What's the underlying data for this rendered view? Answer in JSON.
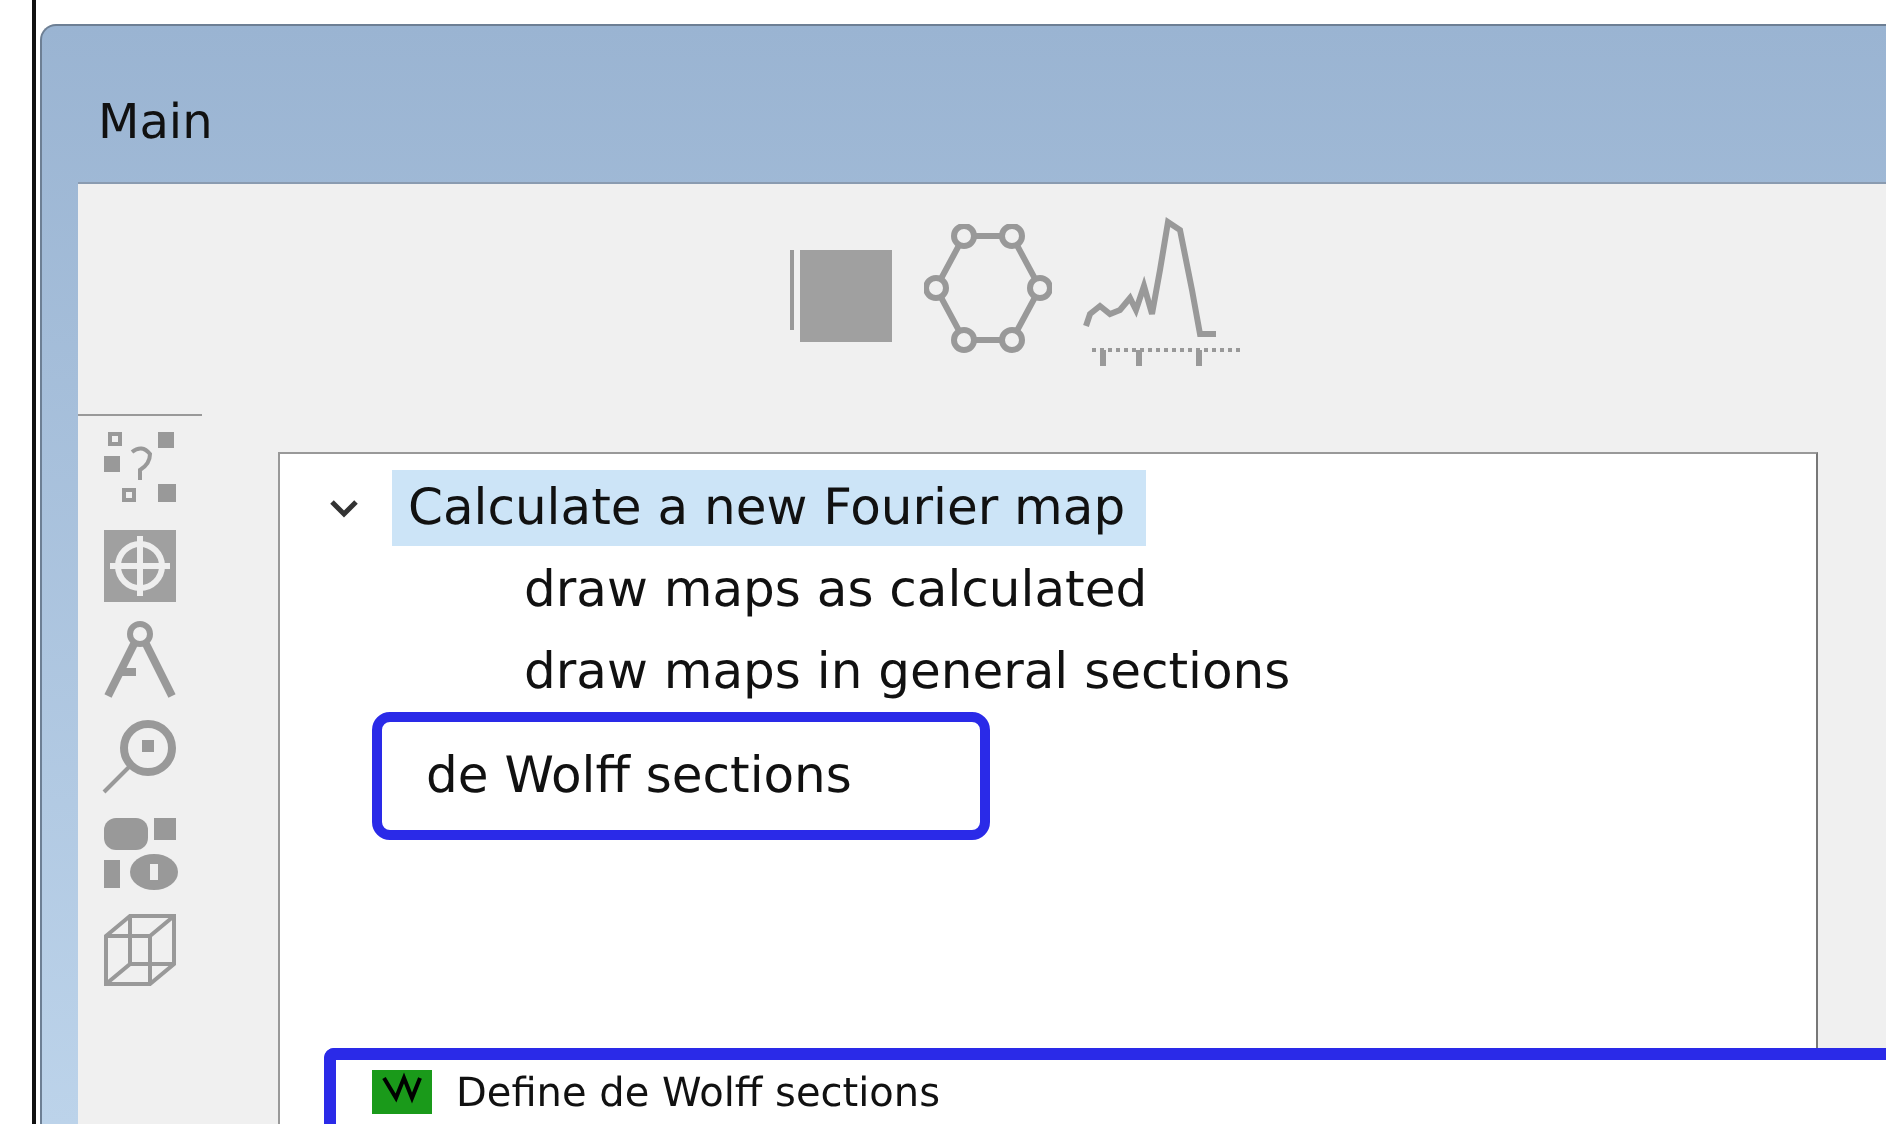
{
  "window": {
    "title": "Main"
  },
  "tree": [
    {
      "label": "Calculate a new Fourier map",
      "expanded": true,
      "selected": true,
      "children": [
        {
          "label": "draw maps as calculated",
          "selected": false
        },
        {
          "label": "draw maps in general sections",
          "selected": false
        }
      ]
    },
    {
      "label": "de Wolff sections",
      "selected": false,
      "highlighted": true
    }
  ],
  "dialog": {
    "title": "Define de Wolff sections",
    "highlighted": true
  }
}
